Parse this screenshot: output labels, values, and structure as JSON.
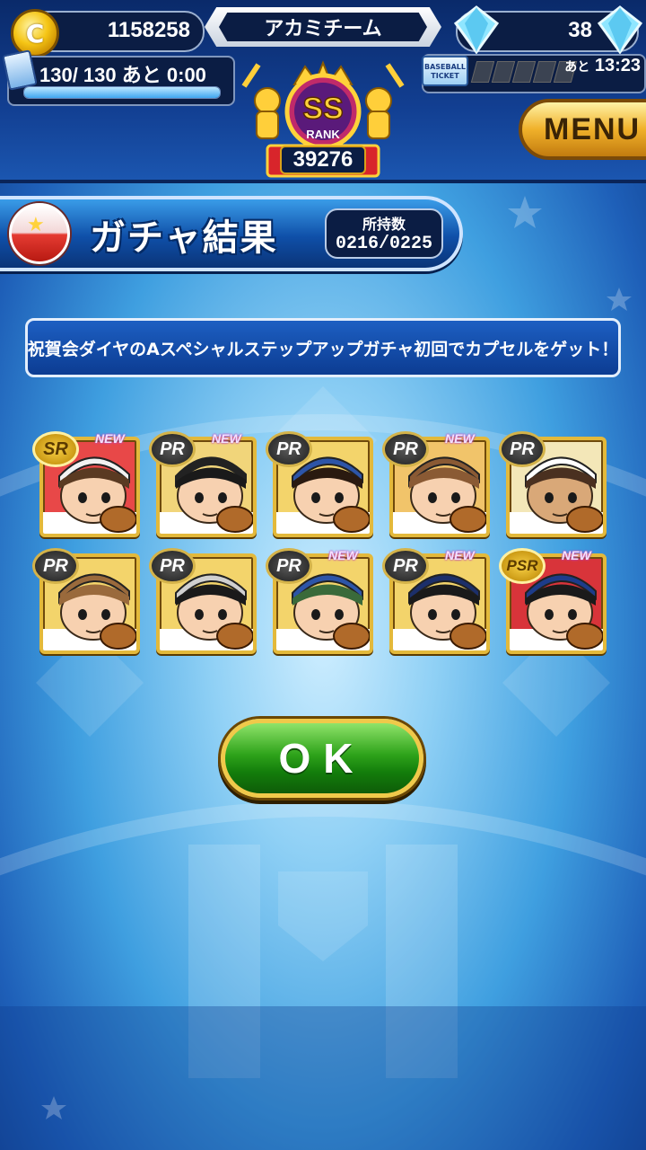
{
  "header": {
    "coins": "1158258",
    "team_name": "アカミチーム",
    "diamonds": "38",
    "stamina": "130/ 130",
    "stamina_suffix": "あと  0:00",
    "stamina_fill_fraction": 1.0,
    "ticket_label": "BASEBALL TICKET",
    "ticket_time_prefix": "あと",
    "ticket_time": "13:23",
    "rank": "SS",
    "rank_label": "RANK",
    "rank_score": "39276",
    "menu_label": "MENU"
  },
  "title": {
    "text": "ガチャ結果",
    "owned_label": "所持数",
    "owned_value": "0216/0225"
  },
  "message": "祝賀会ダイヤのAスペシャルステップアップガチャ初回でカプセルをゲット！",
  "cards": [
    {
      "rarity": "SR",
      "new": "NEW",
      "bg": "#e84848",
      "cap": "#f2f2f2",
      "hair": "#5a3a22",
      "skin": "#f7d1b0"
    },
    {
      "rarity": "PR",
      "new": "NEW",
      "bg": "#f1d57a",
      "cap": "#222222",
      "hair": "#1a1a1a",
      "skin": "#f7d1b0"
    },
    {
      "rarity": "PR",
      "new": "",
      "bg": "#f3d46b",
      "cap": "#2d55a8",
      "hair": "#2a1a10",
      "skin": "#f7d1b0"
    },
    {
      "rarity": "PR",
      "new": "NEW",
      "bg": "#f1c46a",
      "cap": "#8a5a34",
      "hair": "#8a5a34",
      "skin": "#f7d1b0"
    },
    {
      "rarity": "PR",
      "new": "",
      "bg": "#f3e7b8",
      "cap": "#ffffff",
      "hair": "#4a3020",
      "skin": "#d9a878"
    },
    {
      "rarity": "PR",
      "new": "",
      "bg": "#f3d46b",
      "cap": "#9a6a3c",
      "hair": "#9a6a3c",
      "skin": "#f7d1b0"
    },
    {
      "rarity": "PR",
      "new": "",
      "bg": "#f3d46b",
      "cap": "#d0d0d0",
      "hair": "#1a1a1a",
      "skin": "#f7d1b0"
    },
    {
      "rarity": "PR",
      "new": "NEW",
      "bg": "#f3d46b",
      "cap": "#2d55a8",
      "hair": "#3a6a3a",
      "skin": "#f7d1b0"
    },
    {
      "rarity": "PR",
      "new": "NEW",
      "bg": "#f3d46b",
      "cap": "#1c2f6a",
      "hair": "#1a1a1a",
      "skin": "#f7d1b0"
    },
    {
      "rarity": "PSR",
      "new": "NEW",
      "bg": "#d8343a",
      "cap": "#1d3c8a",
      "hair": "#1a1a1a",
      "skin": "#f7d1b0"
    }
  ],
  "ok_label": "OK"
}
